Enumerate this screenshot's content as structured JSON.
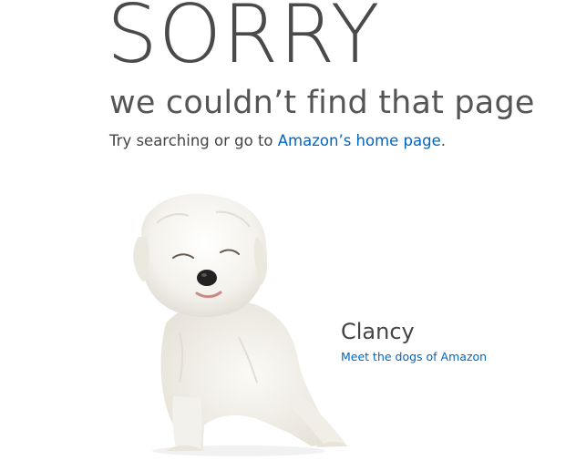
{
  "headline": "SORRY",
  "subheadline": "we couldn’t find that page",
  "try_line": {
    "prefix": "Try searching or go to ",
    "link_label": "Amazon’s home page",
    "suffix": "."
  },
  "dog": {
    "name": "Clancy",
    "link_label": "Meet the dogs of Amazon"
  },
  "colors": {
    "text_dark": "#444444",
    "link": "#0066c0",
    "background": "#ffffff"
  }
}
